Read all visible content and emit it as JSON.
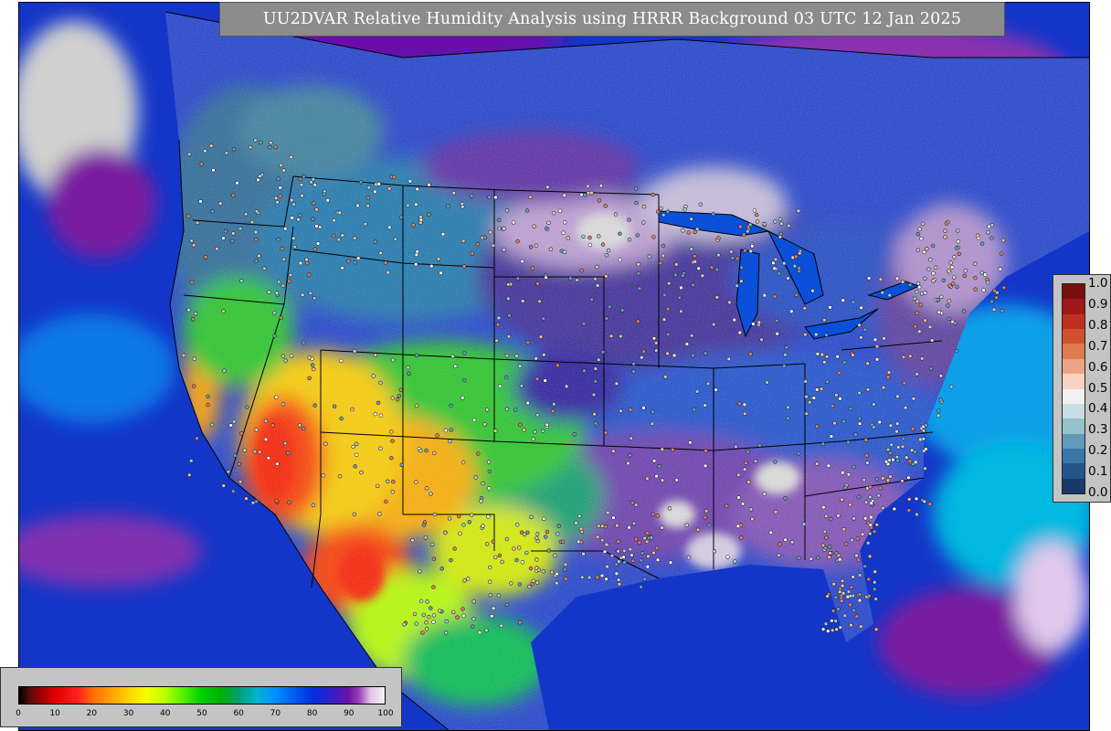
{
  "title": "UU2DVAR Relative Humidity Analysis using HRRR Background 03 UTC 12 Jan 2025",
  "rh_colorbar": {
    "tick_labels": [
      "0",
      "10",
      "20",
      "30",
      "40",
      "50",
      "60",
      "70",
      "80",
      "90",
      "100"
    ],
    "stops": [
      {
        "v": 0,
        "c": "#000000"
      },
      {
        "v": 3,
        "c": "#5a0c0c"
      },
      {
        "v": 6,
        "c": "#a00000"
      },
      {
        "v": 10,
        "c": "#e00000"
      },
      {
        "v": 16,
        "c": "#ff2020"
      },
      {
        "v": 20,
        "c": "#ff6a00"
      },
      {
        "v": 25,
        "c": "#ffa000"
      },
      {
        "v": 30,
        "c": "#ffd200"
      },
      {
        "v": 35,
        "c": "#f2ff00"
      },
      {
        "v": 40,
        "c": "#b8ff00"
      },
      {
        "v": 45,
        "c": "#50f000"
      },
      {
        "v": 50,
        "c": "#00d000"
      },
      {
        "v": 55,
        "c": "#00b000"
      },
      {
        "v": 60,
        "c": "#00a070"
      },
      {
        "v": 65,
        "c": "#00b4d0"
      },
      {
        "v": 70,
        "c": "#0090ff"
      },
      {
        "v": 75,
        "c": "#0060f0"
      },
      {
        "v": 80,
        "c": "#0030e0"
      },
      {
        "v": 85,
        "c": "#3020c8"
      },
      {
        "v": 90,
        "c": "#6a10a8"
      },
      {
        "v": 93,
        "c": "#9a40b8"
      },
      {
        "v": 96,
        "c": "#e0c0e8"
      },
      {
        "v": 100,
        "c": "#f4f4f4"
      }
    ]
  },
  "diff_colorbar": {
    "tick_labels": [
      "1.0",
      "0.9",
      "0.8",
      "0.7",
      "0.6",
      "0.5",
      "0.4",
      "0.3",
      "0.2",
      "0.1",
      "0.0"
    ],
    "colors": [
      "#1a3a6a",
      "#24558a",
      "#3a76a8",
      "#5f9ab8",
      "#93c2c8",
      "#c8dde4",
      "#f2f2f2",
      "#f8d2c0",
      "#eca484",
      "#e07a50",
      "#d05030",
      "#c03020",
      "#a01818",
      "#781010"
    ]
  },
  "map_colors": {
    "ocean": "#1436c8",
    "dry_core": "#ff2a00",
    "land_dark": "#2a3a5a",
    "border": "#000000"
  }
}
